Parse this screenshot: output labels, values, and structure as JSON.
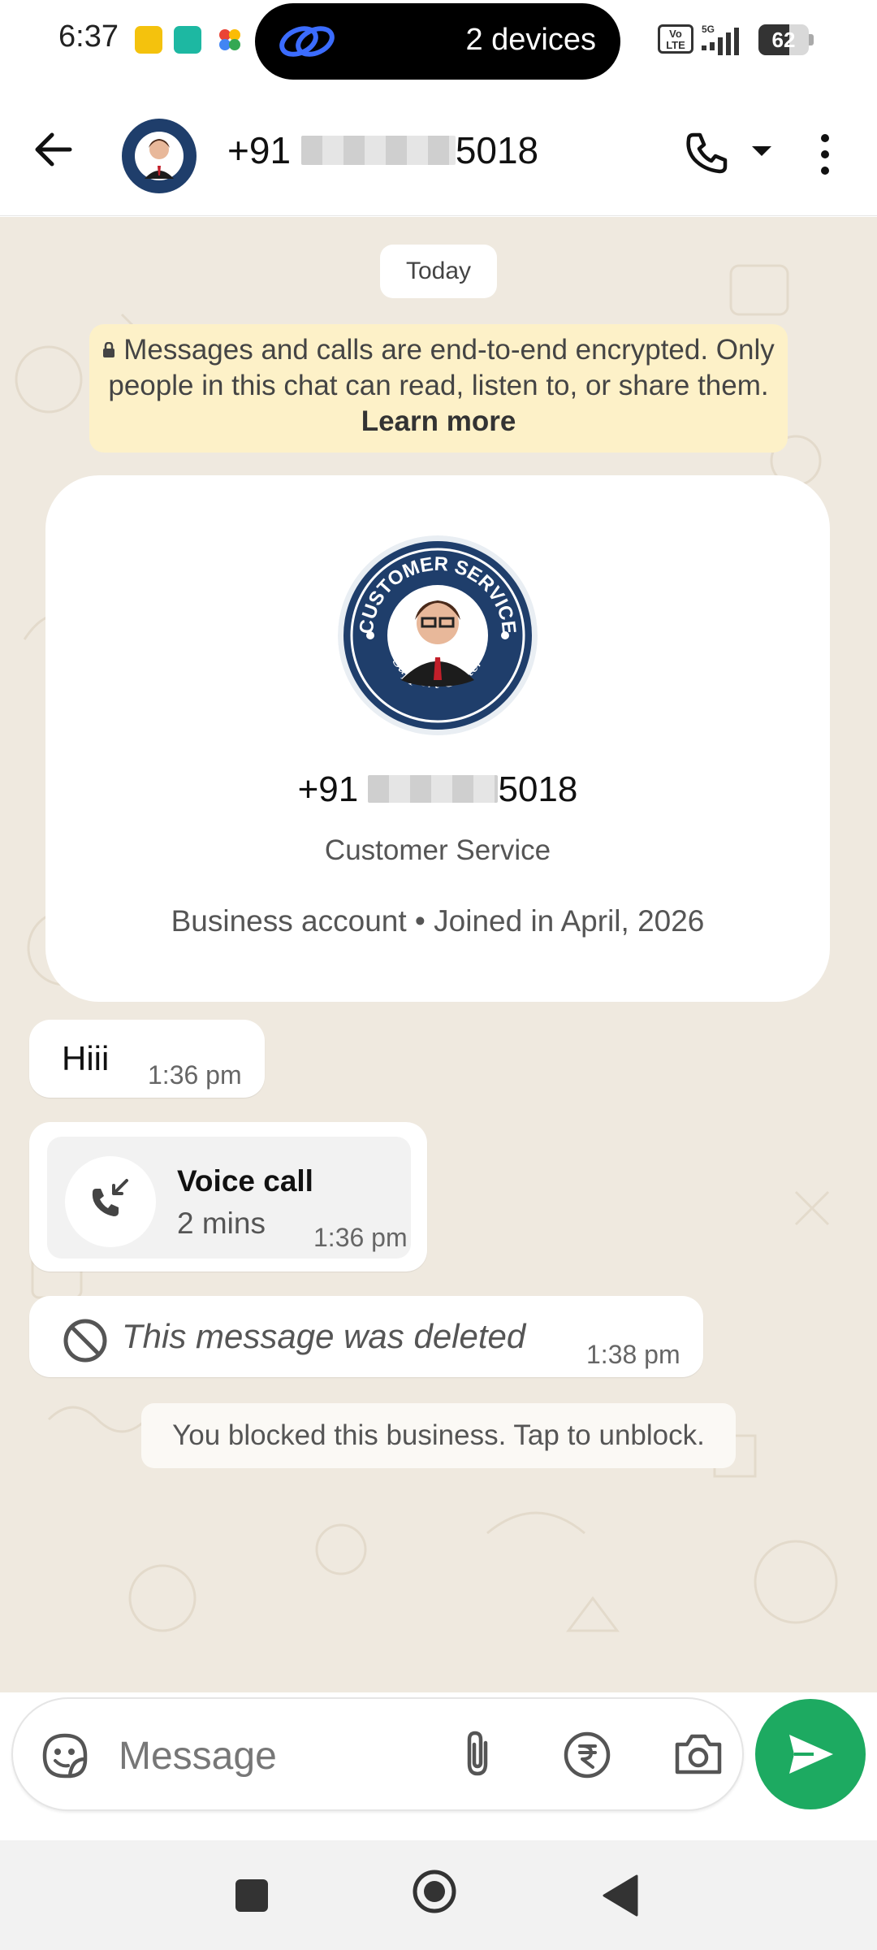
{
  "status_bar": {
    "time": "6:37",
    "pill_text": "2 devices",
    "network_label": "VoLTE",
    "network_type": "5G",
    "battery_level": "62",
    "battery_fraction": 0.62
  },
  "header": {
    "number_prefix": "+91",
    "number_suffix": "5018",
    "back_icon": "arrow-back-icon",
    "call_icon": "phone-icon",
    "menu_icon": "more-vertical-icon"
  },
  "chat": {
    "date_label": "Today",
    "encryption_text": "Messages and calls are end-to-end encrypted. Only people in this chat can read, listen to, or share them.",
    "encryption_link": "Learn more",
    "business_card": {
      "avatar_text_top": "CUSTOMER SERVICE",
      "avatar_text_bottom": "Support Center",
      "number_prefix": "+91",
      "number_suffix": "5018",
      "name": "Customer Service",
      "info": "Business account • Joined in April, 2026"
    },
    "messages": [
      {
        "type": "text",
        "text": "Hiii",
        "time": "1:36 pm"
      },
      {
        "type": "call",
        "title": "Voice call",
        "duration": "2 mins",
        "time": "1:36 pm"
      },
      {
        "type": "deleted",
        "text": "This message was deleted",
        "time": "1:38 pm"
      }
    ],
    "blocked_notice": "You blocked this business. Tap to unblock."
  },
  "input_bar": {
    "placeholder": "Message"
  },
  "colors": {
    "accent_green": "#1daa61",
    "chat_background": "#efe9df",
    "encryption_banner": "#fdf1c8"
  }
}
